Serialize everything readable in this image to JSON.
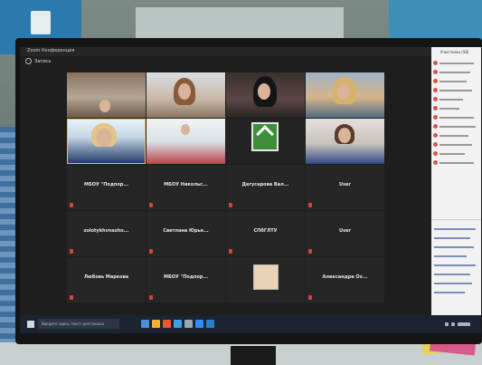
{
  "window": {
    "title": "Zoom Конференция",
    "toolbar_label": "Запись"
  },
  "tiles": [
    {
      "name": "",
      "caption": ""
    },
    {
      "name": "",
      "caption": ""
    },
    {
      "name": "",
      "caption": ""
    },
    {
      "name": "",
      "caption": ""
    },
    {
      "name": "",
      "caption": ""
    },
    {
      "name": "",
      "caption": ""
    },
    {
      "name": "",
      "caption": ""
    },
    {
      "name": "",
      "caption": ""
    },
    {
      "name": "МБОУ \"Подпор...",
      "caption": ""
    },
    {
      "name": "МБОУ Никольс...",
      "caption": ""
    },
    {
      "name": "Дегусарова Вал...",
      "caption": ""
    },
    {
      "name": "User",
      "caption": ""
    },
    {
      "name": "zolotykhvnasho...",
      "caption": ""
    },
    {
      "name": "Светлана Юрье...",
      "caption": ""
    },
    {
      "name": "СПбГЛТУ",
      "caption": ""
    },
    {
      "name": "User",
      "caption": ""
    },
    {
      "name": "Любовь Маркова",
      "caption": ""
    },
    {
      "name": "МБОУ \"Подпор...",
      "caption": ""
    },
    {
      "name": "",
      "caption": ""
    },
    {
      "name": "Александра Ох...",
      "caption": ""
    }
  ],
  "panel": {
    "title": "Участники (58)"
  },
  "taskbar": {
    "search_placeholder": "Введите здесь текст для поиска"
  }
}
